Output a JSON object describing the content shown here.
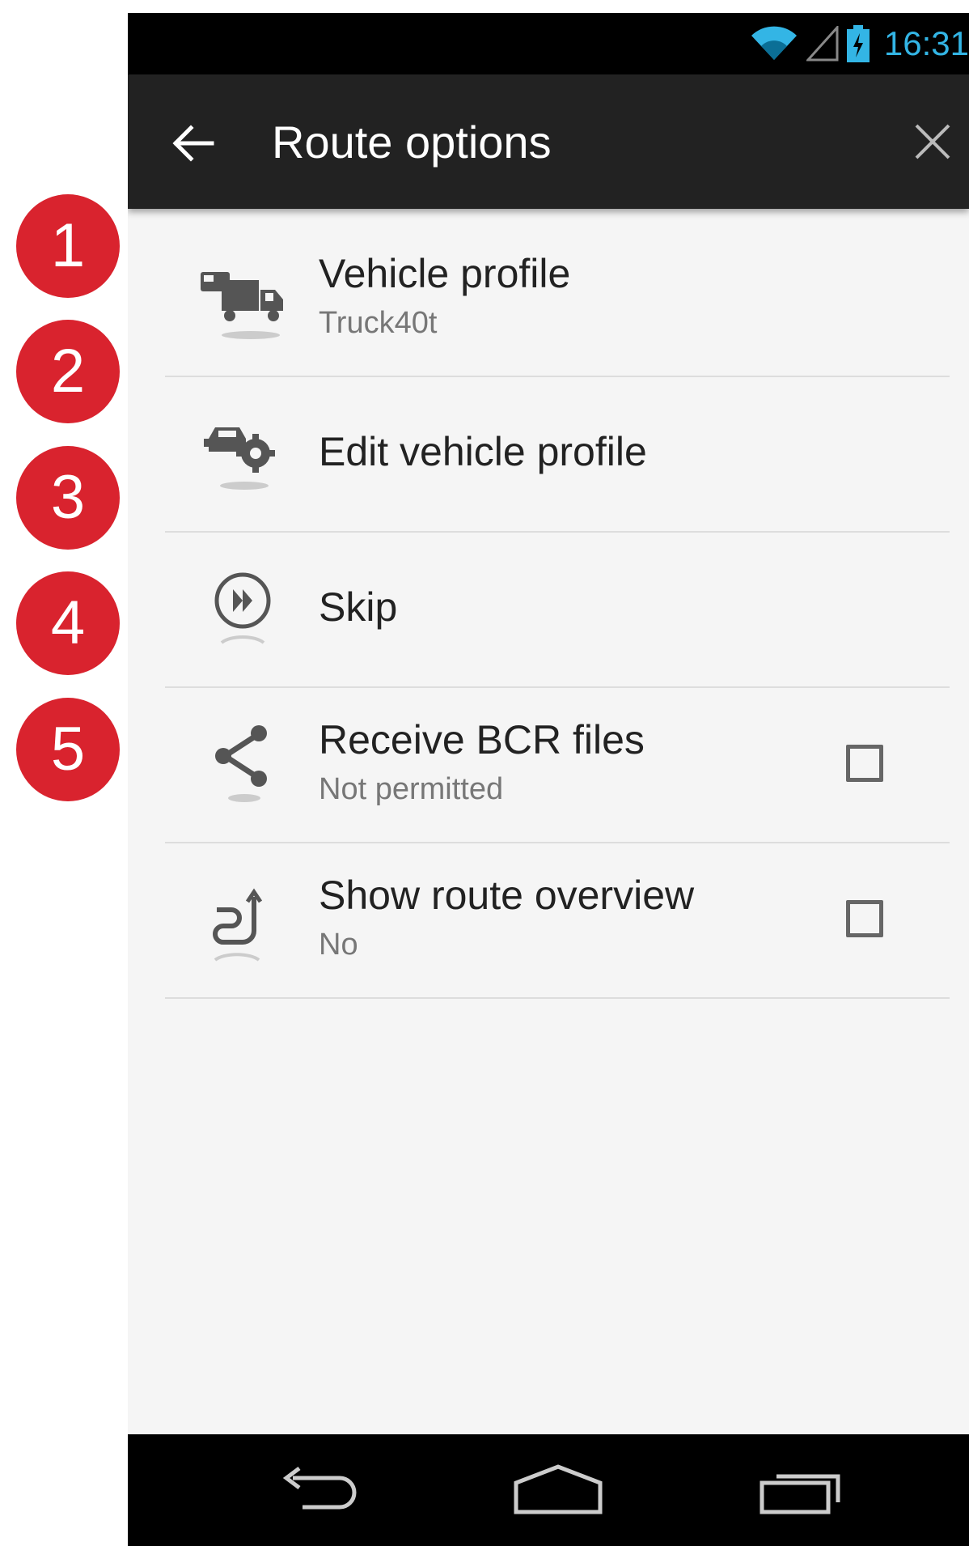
{
  "annotations": [
    "1",
    "2",
    "3",
    "4",
    "5"
  ],
  "status_bar": {
    "time": "16:31",
    "accent_color": "#33b5e5"
  },
  "app_bar": {
    "title": "Route options",
    "back_icon": "arrow-left-icon",
    "close_icon": "close-icon"
  },
  "items": [
    {
      "icon": "truck-icon",
      "title": "Vehicle profile",
      "subtitle": "Truck40t"
    },
    {
      "icon": "vehicle-settings-icon",
      "title": "Edit vehicle profile"
    },
    {
      "icon": "skip-forward-icon",
      "title": "Skip"
    },
    {
      "icon": "share-icon",
      "title": "Receive BCR files",
      "subtitle": "Not permitted",
      "checked": false
    },
    {
      "icon": "route-overview-icon",
      "title": "Show route overview",
      "subtitle": "No",
      "checked": false
    }
  ],
  "nav_bar": {
    "icons": [
      "nav-back-icon",
      "nav-home-icon",
      "nav-recents-icon"
    ]
  },
  "colors": {
    "badge": "#d9232e",
    "app_bar": "#222222",
    "list_background": "#f5f5f5"
  }
}
